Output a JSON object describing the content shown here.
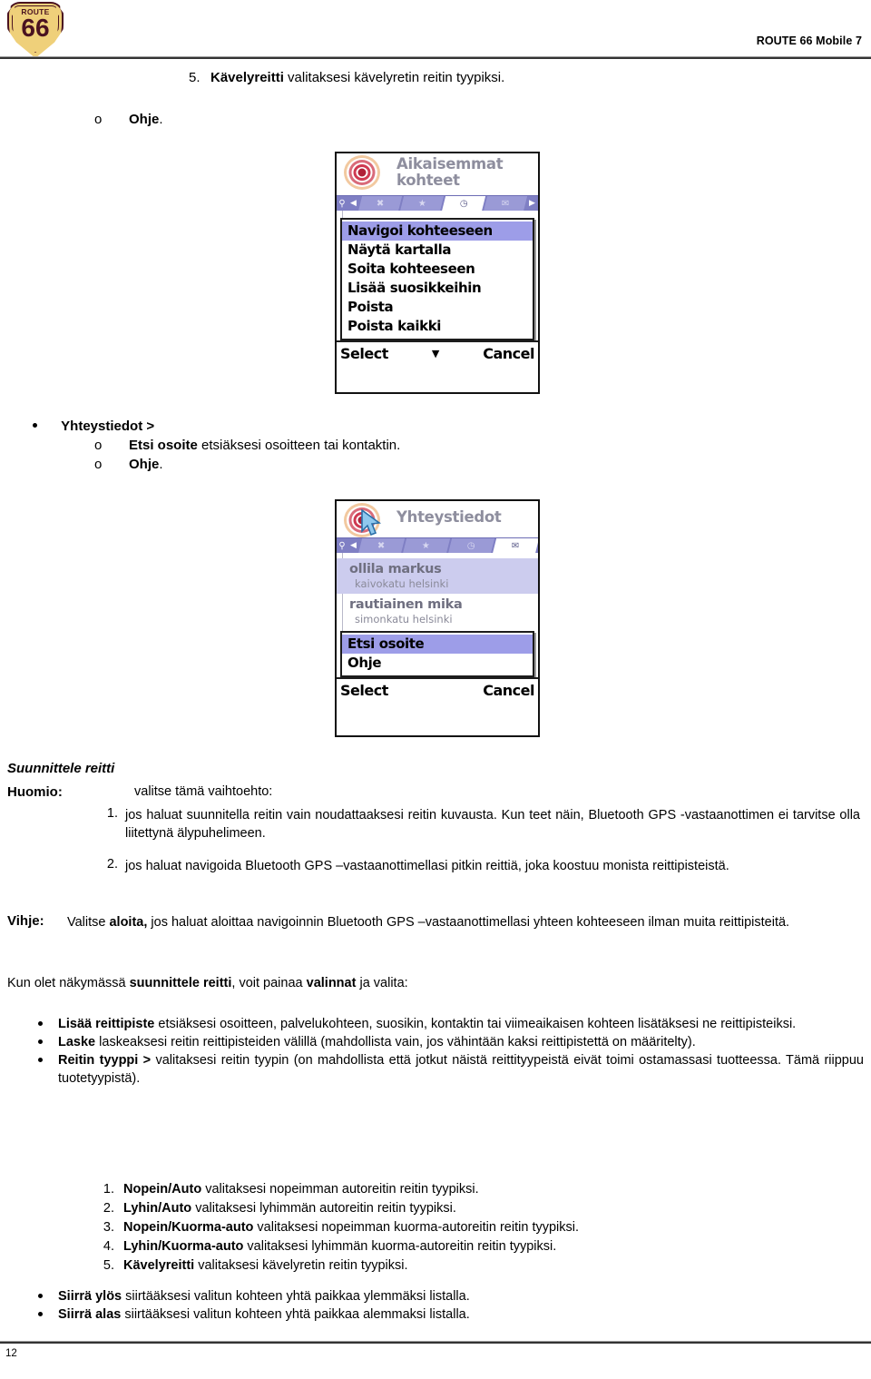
{
  "header": {
    "logo": {
      "route_word": "ROUTE",
      "number": "66",
      "name": "route-66-shield-logo"
    },
    "title": "ROUTE 66 Mobile 7"
  },
  "top_item": {
    "number": "5.",
    "bold": "Kävelyreitti",
    "rest": " valitaksesi kävelyretin reitin tyypiksi."
  },
  "top_sub": {
    "marker": "o",
    "bold": "Ohje",
    "rest": "."
  },
  "screenshot1": {
    "title": "Aikaisemmat kohteet",
    "title_line1": "Aikaisemmat",
    "title_line2": "kohteet",
    "tabs": [
      {
        "icon": "◀",
        "name": "prev-arrow"
      },
      {
        "icon": "✖",
        "name": "close-tab"
      },
      {
        "icon": "★",
        "name": "favourites-tab"
      },
      {
        "icon": "◷",
        "name": "recent-tab",
        "active": true
      },
      {
        "icon": "✉",
        "name": "contacts-tab"
      },
      {
        "icon": "▶",
        "name": "next-arrow"
      }
    ],
    "menu": [
      {
        "label": "Navigoi kohteeseen",
        "selected": true
      },
      {
        "label": "Näytä kartalla",
        "selected": false
      },
      {
        "label": "Soita kohteeseen",
        "selected": false
      },
      {
        "label": "Lisää suosikkeihin",
        "selected": false
      },
      {
        "label": "Poista",
        "selected": false
      },
      {
        "label": "Poista kaikki",
        "selected": false
      }
    ],
    "softkey_left": "Select",
    "softkey_mid": "▼",
    "softkey_right": "Cancel"
  },
  "bullet_yhteystiedot": {
    "label": "Yhteystiedot >"
  },
  "sub_etsi": {
    "marker": "o",
    "bold": "Etsi osoite",
    "rest": " etsiäksesi osoitteen tai kontaktin."
  },
  "sub_ohje": {
    "marker": "o",
    "bold": "Ohje",
    "rest": "."
  },
  "screenshot2": {
    "title": "Yhteystiedot",
    "tabs": [
      {
        "icon": "◀",
        "name": "prev-arrow"
      },
      {
        "icon": "✖",
        "name": "close-tab"
      },
      {
        "icon": "★",
        "name": "favourites-tab"
      },
      {
        "icon": "◷",
        "name": "recent-tab"
      },
      {
        "icon": "✉",
        "name": "contacts-tab",
        "active": true
      }
    ],
    "contacts": [
      {
        "name": "ollila markus",
        "address": "kaivokatu helsinki",
        "selected": true
      },
      {
        "name": "rautiainen mika",
        "address": "simonkatu helsinki",
        "selected": false
      }
    ],
    "menu": [
      {
        "label": "Etsi osoite",
        "selected": true
      },
      {
        "label": "Ohje",
        "selected": false
      }
    ],
    "softkey_left": "Select",
    "softkey_right": "Cancel"
  },
  "suunnittele_heading": "Suunnittele reitti",
  "huomio": {
    "label": "Huomio:",
    "intro": "valitse tämä vaihtoehto:",
    "items": [
      {
        "num": "1.",
        "text": "jos haluat suunnitella reitin vain noudattaaksesi reitin kuvausta. Kun teet näin, Bluetooth GPS -vastaanottimen ei tarvitse olla liitettynä älypuhelimeen."
      },
      {
        "num": "2.",
        "text": "jos haluat navigoida Bluetooth GPS –vastaanottimellasi pitkin reittiä, joka koostuu monista reittipisteistä."
      }
    ]
  },
  "vihje": {
    "label": "Vihje:",
    "pre": "Valitse ",
    "bold": "aloita,",
    "post": " jos haluat aloittaa navigoinnin Bluetooth GPS –vastaanottimellasi yhteen kohteeseen ilman muita reittipisteitä."
  },
  "kun_olet": {
    "p1": "Kun olet näkymässä ",
    "b1": "suunnittele reitti",
    "p2": ", voit painaa ",
    "b2": "valinnat",
    "p3": " ja valita:"
  },
  "options_bullets": [
    {
      "bold": "Lisää reittipiste",
      "rest": " etsiäksesi osoitteen, palvelukohteen, suosikin, kontaktin tai viimeaikaisen kohteen lisätäksesi ne reittipisteiksi."
    },
    {
      "bold": "Laske",
      "rest": " laskeaksesi reitin reittipisteiden välillä (mahdollista vain, jos vähintään kaksi reittipistettä on määritelty)."
    },
    {
      "bold": "Reitin tyyppi >",
      "rest": " valitaksesi reitin tyypin (on mahdollista että jotkut näistä reittityypeistä eivät toimi ostamassasi tuotteessa. Tämä riippuu tuotetyypistä)."
    }
  ],
  "route_types": [
    {
      "num": "1.",
      "bold": "Nopein/Auto",
      "rest": " valitaksesi nopeimman autoreitin reitin tyypiksi."
    },
    {
      "num": "2.",
      "bold": "Lyhin/Auto",
      "rest": " valitaksesi lyhimmän autoreitin reitin tyypiksi."
    },
    {
      "num": "3.",
      "bold": "Nopein/Kuorma-auto",
      "rest": " valitaksesi nopeimman kuorma-autoreitin reitin tyypiksi."
    },
    {
      "num": "4.",
      "bold": "Lyhin/Kuorma-auto",
      "rest": " valitaksesi lyhimmän kuorma-autoreitin reitin tyypiksi."
    },
    {
      "num": "5.",
      "bold": "Kävelyreitti",
      "rest": " valitaksesi kävelyretin reitin tyypiksi."
    }
  ],
  "move_bullets": [
    {
      "bold": "Siirrä ylös",
      "rest": " siirtääksesi valitun kohteen yhtä paikkaa ylemmäksi listalla."
    },
    {
      "bold": "Siirrä alas",
      "rest": " siirtääksesi valitun kohteen yhtä paikkaa alemmaksi listalla."
    }
  ],
  "footer": {
    "page_number": "12"
  },
  "colors": {
    "logo_gold": "#efd07a",
    "logo_maroon": "#4a1220",
    "tabbar_purple": "#7f7fc4",
    "menu_highlight": "#9d9de8",
    "contact_highlight": "#ccccee",
    "phone_title_gray": "#8e8e9e"
  }
}
